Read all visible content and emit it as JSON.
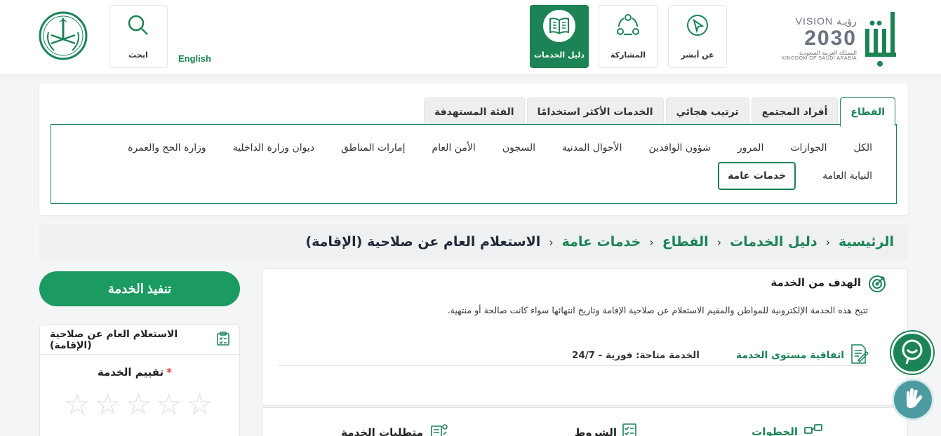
{
  "header": {
    "brand": {
      "vision_top": "VISION رؤيـة",
      "vision_year": "2030",
      "vision_ar": "المملكة العربية السعودية",
      "vision_en": "KINGDOM OF SAUDI ARABIA",
      "absher_logo": "أبشر"
    },
    "nav": [
      {
        "label": "عن أبشر",
        "icon": "chat-cursor-icon"
      },
      {
        "label": "المشاركة",
        "icon": "share-icon"
      },
      {
        "label": "دليل الخدمات",
        "icon": "book-icon",
        "active": true
      }
    ],
    "search_label": "ابحث",
    "language_link": "English"
  },
  "filter": {
    "tabs": [
      "القطاع",
      "أفراد المجتمع",
      "ترتيب هجائي",
      "الخدمات الأكثر استخدامًا",
      "الفئة المستهدفة"
    ],
    "active_tab": "القطاع",
    "sectors": [
      "الكل",
      "الجوازات",
      "المرور",
      "شؤون الوافدين",
      "الأحوال المدنية",
      "السجون",
      "الأمن العام",
      "إمارات المناطق",
      "ديوان وزارة الداخلية",
      "وزارة الحج والعمرة",
      "النيابة العامة",
      "خدمات عامة"
    ],
    "selected_sector": "خدمات عامة"
  },
  "breadcrumb": [
    "الرئيسية",
    "دليل الخدمات",
    "القطاع",
    "خدمات عامة",
    "الاستعلام العام عن صلاحية (الإقامة)"
  ],
  "side": {
    "execute_button": "تنفيذ الخدمة",
    "service_name": "الاستعلام العام عن صلاحية (الإقامة)",
    "rating_label": "تقييم الخدمة",
    "required_mark": "*",
    "stars": 5
  },
  "main": {
    "goal_title": "الهدف من الخدمة",
    "goal_text": "تتيح هذه الخدمة الإلكترونية للمواطن والمقيم الاستعلام عن صلاحية الإقامة وتاريخ انتهائها سواء كانت صالحة أو منتهية.",
    "sla_title": "اتفاقية مستوى الخدمة",
    "sla_value": "الخدمة متاحة: فورية - 24/7"
  },
  "bottom": {
    "steps": "الخطوات",
    "terms": "الشروط",
    "requirements": "متطلبات الخدمة"
  },
  "colors": {
    "primary": "#1b8354",
    "button": "#1b9a62",
    "sign": "#4c9ba0"
  }
}
